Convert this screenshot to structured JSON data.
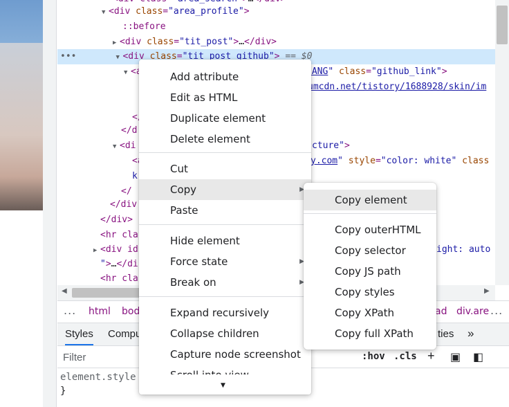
{
  "dom": {
    "lines": [
      {
        "text": "  <div class=\"area_search\">…</div>"
      },
      {
        "text": "<div class=\"area_profile\">"
      },
      {
        "text": "::before"
      },
      {
        "text": "<div class=\"tit_post\">…</div>"
      },
      {
        "text": "<div class=\"tit_post_github\"> == $0"
      },
      {
        "text": "<a ...UANG\" class=\"github_link\">"
      },
      {
        "text": "...umcdn.net/tistory/1688928/skin/im"
      },
      {
        "text": "</a>"
      },
      {
        "text": "</div>"
      },
      {
        "text": "<div ...cture\">"
      },
      {
        "text": "<a ...y.com\" style=\"color: white\" class"
      },
      {
        "text": "k\""
      },
      {
        "text": "</a>"
      },
      {
        "text": "</div>"
      },
      {
        "text": "</div>"
      },
      {
        "text": "<hr cla"
      },
      {
        "text": "<div id ...ight: auto"
      },
      {
        "text": "\">…</di"
      },
      {
        "text": "<hr cla"
      }
    ],
    "ellipsis": "…",
    "github_link_class": "github_link",
    "tail_image": "umcdn.net/tistory/1688928/skin/im",
    "link_frag": "y.com",
    "style_frag": " style=\"color: white\" class",
    "height_frag": "ight: auto",
    "jang": "JANG\"",
    "eq_dollar": "== $0",
    "cture": "cture\">"
  },
  "breadcrumb": {
    "dots": "...",
    "items": [
      "html",
      "bod",
      "ad",
      "div.are"
    ],
    "more": "..."
  },
  "styles_tabs": [
    "Styles",
    "Compu",
    "ties"
  ],
  "styles_more": "»",
  "filter": {
    "placeholder": "Filter",
    "hov": ":hov",
    "cls": ".cls"
  },
  "rules": {
    "selector": "element.style {",
    "close": "}"
  },
  "context_menu": {
    "items": [
      {
        "label": "Add attribute"
      },
      {
        "label": "Edit as HTML"
      },
      {
        "label": "Duplicate element"
      },
      {
        "label": "Delete element"
      },
      {
        "label": "Cut"
      },
      {
        "label": "Copy"
      },
      {
        "label": "Paste"
      },
      {
        "label": "Hide element"
      },
      {
        "label": "Force state"
      },
      {
        "label": "Break on"
      },
      {
        "label": "Expand recursively"
      },
      {
        "label": "Collapse children"
      },
      {
        "label": "Capture node screenshot"
      },
      {
        "label": "Scroll into view"
      }
    ]
  },
  "copy_submenu": {
    "items": [
      {
        "label": "Copy element"
      },
      {
        "label": "Copy outerHTML"
      },
      {
        "label": "Copy selector"
      },
      {
        "label": "Copy JS path"
      },
      {
        "label": "Copy styles"
      },
      {
        "label": "Copy XPath"
      },
      {
        "label": "Copy full XPath"
      }
    ]
  },
  "colors": {
    "tag": "#881280",
    "attr": "#994500",
    "value": "#1a1aa6",
    "selection": "#cfe8fc",
    "accent": "#1a73e8"
  }
}
